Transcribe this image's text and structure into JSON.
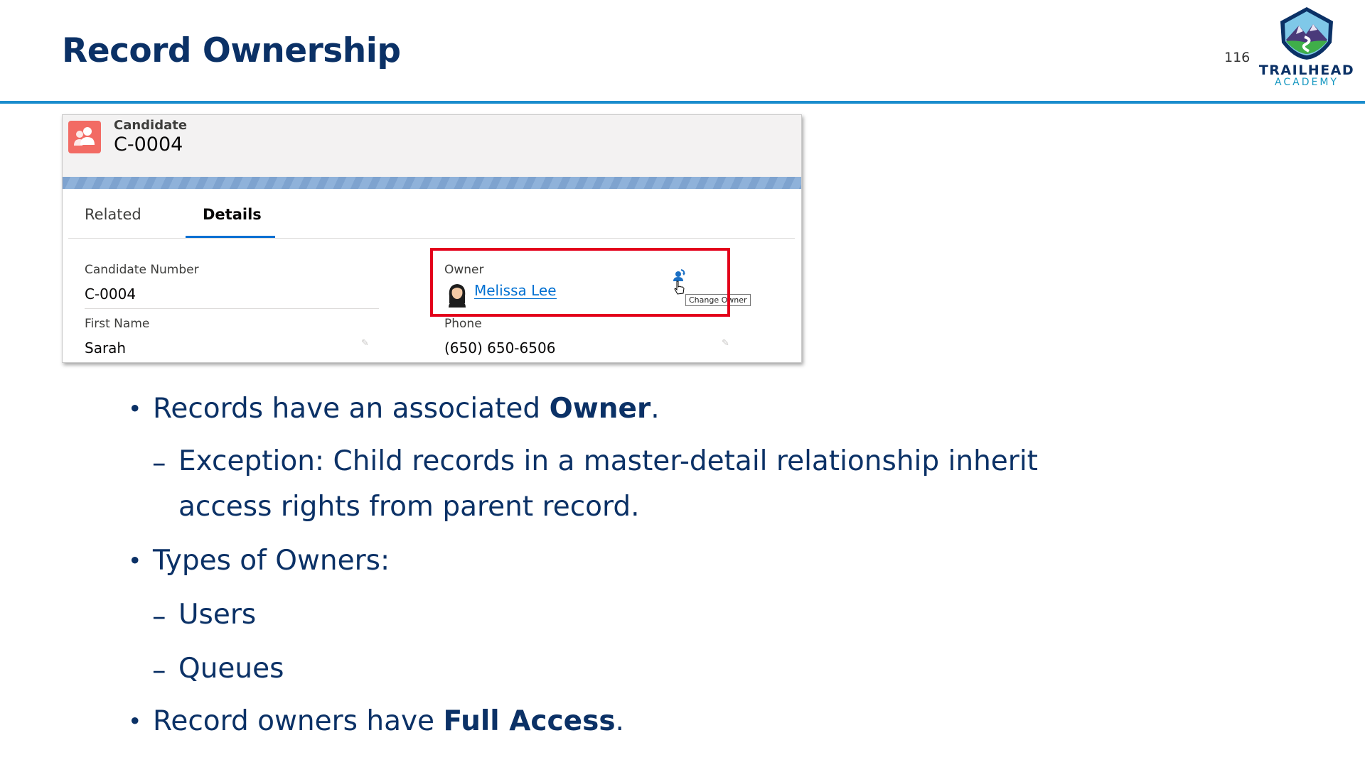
{
  "slide": {
    "title": "Record Ownership",
    "page_number": "116",
    "logo_line1": "TRAILHEAD",
    "logo_line2": "ACADEMY"
  },
  "record": {
    "object_label": "Candidate",
    "record_name": "C-0004",
    "tabs": [
      {
        "label": "Related",
        "active": false
      },
      {
        "label": "Details",
        "active": true
      }
    ],
    "fields": {
      "candidate_number": {
        "label": "Candidate Number",
        "value": "C-0004"
      },
      "first_name": {
        "label": "First Name",
        "value": "Sarah"
      },
      "owner": {
        "label": "Owner",
        "value": "Melissa Lee"
      },
      "phone": {
        "label": "Phone",
        "value": "(650) 650-6506"
      }
    },
    "change_owner_tooltip": "Change Owner"
  },
  "bullets": {
    "b1_prefix": "Records have an associated ",
    "b1_bold": "Owner",
    "b1_suffix": ".",
    "b1_sub_line1": "Exception: Child records in a master-detail relationship inherit",
    "b1_sub_line2": "access rights from parent record.",
    "b2": "Types of Owners:",
    "b2_sub1": "Users",
    "b2_sub2": "Queues",
    "b3_prefix": "Record owners have ",
    "b3_bold": "Full Access",
    "b3_suffix": "."
  },
  "colors": {
    "title": "#0b3166",
    "rule": "#1a8ccd",
    "highlight_box": "#e3001b",
    "link": "#0070d2",
    "object_icon": "#f26b64"
  }
}
